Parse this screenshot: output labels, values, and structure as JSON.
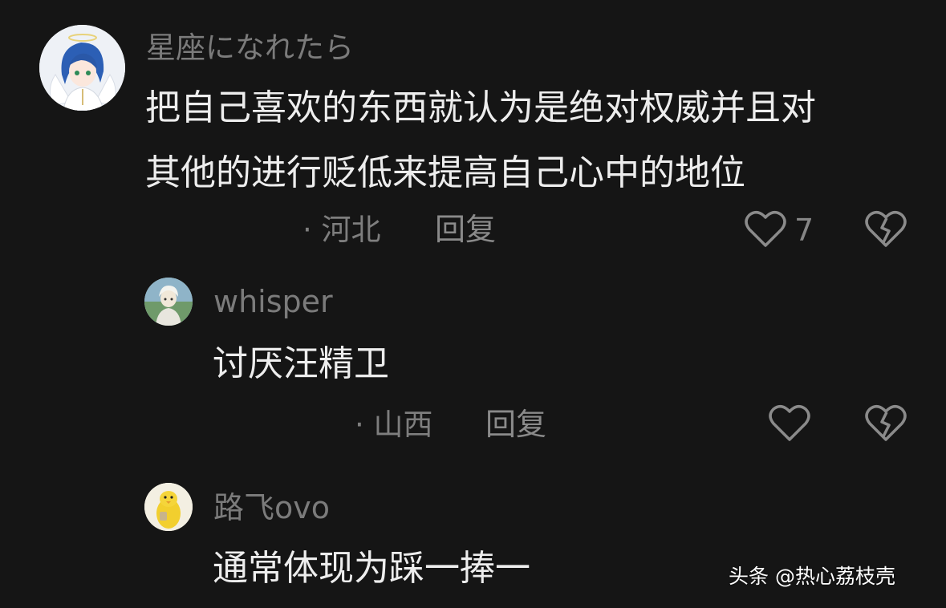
{
  "comments": [
    {
      "username": "星座になれたら",
      "lines": [
        "把自己喜欢的东西就认为是绝对权威并且对",
        "其他的进行贬低来提高自己心中的地位"
      ],
      "location": "· 河北",
      "reply_label": "回复",
      "like_count": "7",
      "avatar_icon": "angel-girl-avatar"
    },
    {
      "username": "whisper",
      "lines": [
        "讨厌汪精卫"
      ],
      "location": "· 山西",
      "reply_label": "回复",
      "like_count": "",
      "avatar_icon": "anime-character-avatar"
    },
    {
      "username": "路飞ovo",
      "lines": [
        "通常体现为踩一捧一"
      ],
      "avatar_icon": "yellow-chick-avatar"
    }
  ],
  "watermark": "头条 @热心荔枝壳",
  "colors": {
    "background": "#151515",
    "text_primary": "#ededed",
    "text_secondary": "#7b7b7b"
  }
}
